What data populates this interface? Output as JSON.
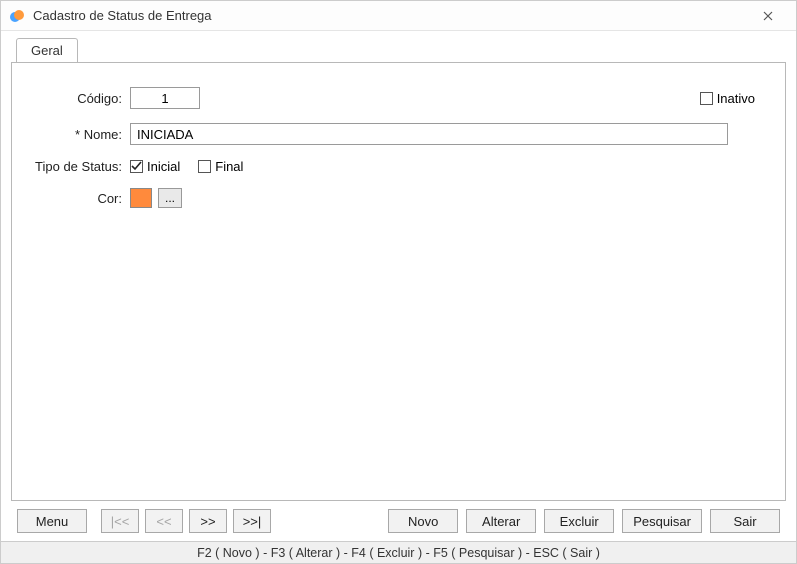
{
  "window": {
    "title": "Cadastro de Status de Entrega"
  },
  "tabs": {
    "geral": "Geral"
  },
  "form": {
    "codigo_label": "Código:",
    "codigo_value": "1",
    "inativo_label": "Inativo",
    "inativo_checked": false,
    "nome_label": "* Nome:",
    "nome_value": "INICIADA",
    "tipo_label": "Tipo de Status:",
    "inicial_label": "Inicial",
    "inicial_checked": true,
    "final_label": "Final",
    "final_checked": false,
    "cor_label": "Cor:",
    "cor_value": "#ff8a3c",
    "cor_picker_label": "..."
  },
  "footer": {
    "menu": "Menu",
    "nav_first": "|<<",
    "nav_prev": "<<",
    "nav_next": ">>",
    "nav_last": ">>|",
    "novo": "Novo",
    "alterar": "Alterar",
    "excluir": "Excluir",
    "pesquisar": "Pesquisar",
    "sair": "Sair"
  },
  "status_strip": "F2 ( Novo )  -  F3 ( Alterar )  -  F4 ( Excluir )  -  F5 ( Pesquisar )  -  ESC ( Sair )"
}
